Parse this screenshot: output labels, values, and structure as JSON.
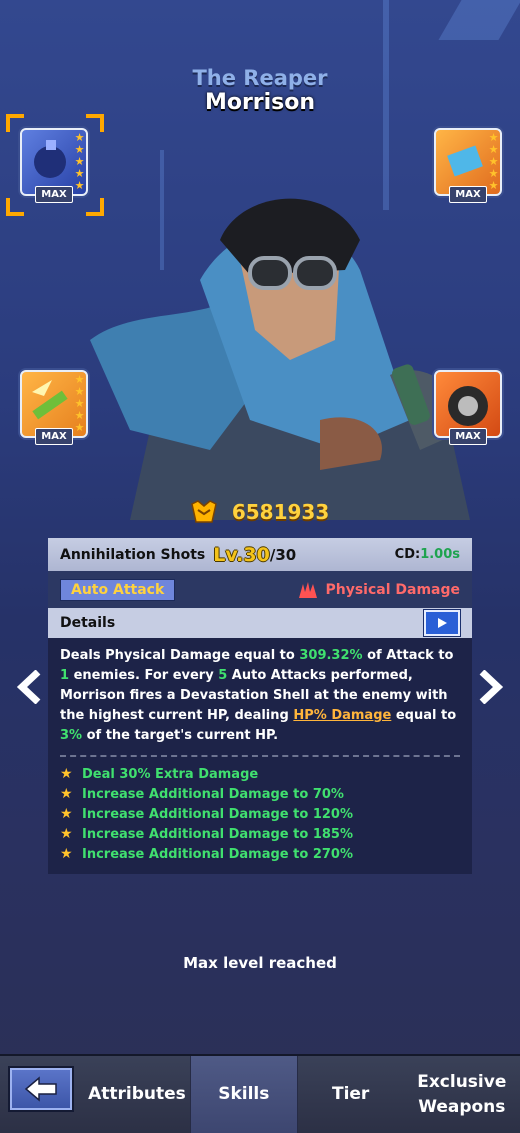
{
  "hero": {
    "title": "The Reaper",
    "name": "Morrison",
    "power": "6581933"
  },
  "gear": [
    {
      "slot": "top-left",
      "badge": "MAX",
      "icon": "grenade-icon",
      "selected": true
    },
    {
      "slot": "top-right",
      "badge": "MAX",
      "icon": "chip-icon",
      "selected": false
    },
    {
      "slot": "mid-left",
      "badge": "MAX",
      "icon": "ammo-icon",
      "selected": false
    },
    {
      "slot": "mid-right",
      "badge": "MAX",
      "icon": "wheel-icon",
      "selected": false
    }
  ],
  "skill": {
    "name": "Annihilation Shots",
    "level_label": "Lv.30",
    "level_max": "/30",
    "cd_label": "CD:",
    "cd_value": "1.00s",
    "type": "Auto Attack",
    "damage_type": "Physical Damage",
    "details_label": "Details",
    "desc": {
      "p1": "Deals Physical Damage equal to ",
      "v1": "309.32%",
      "p2": " of Attack to ",
      "v2": "1",
      "p3": " enemies. For every ",
      "v3": "5",
      "p4": " Auto Attacks performed, Morrison fires a Devastation Shell at the enemy with the highest current HP, dealing ",
      "link": "HP% Damage",
      "p5": " equal to ",
      "v4": "3%",
      "p6": " of the target's current HP."
    },
    "upgrades": [
      "Deal 30% Extra Damage",
      "Increase Additional Damage to 70%",
      "Increase Additional Damage to 120%",
      "Increase Additional Damage to 185%",
      "Increase Additional Damage to 270%"
    ]
  },
  "status": "Max level reached",
  "nav": {
    "tabs": [
      "Attributes",
      "Skills",
      "Tier",
      "Exclusive Weapons"
    ],
    "active": "Skills"
  },
  "colors": {
    "accent_gold": "#ffd23e",
    "green": "#40e06f",
    "damage_red": "#ff6a6a"
  }
}
